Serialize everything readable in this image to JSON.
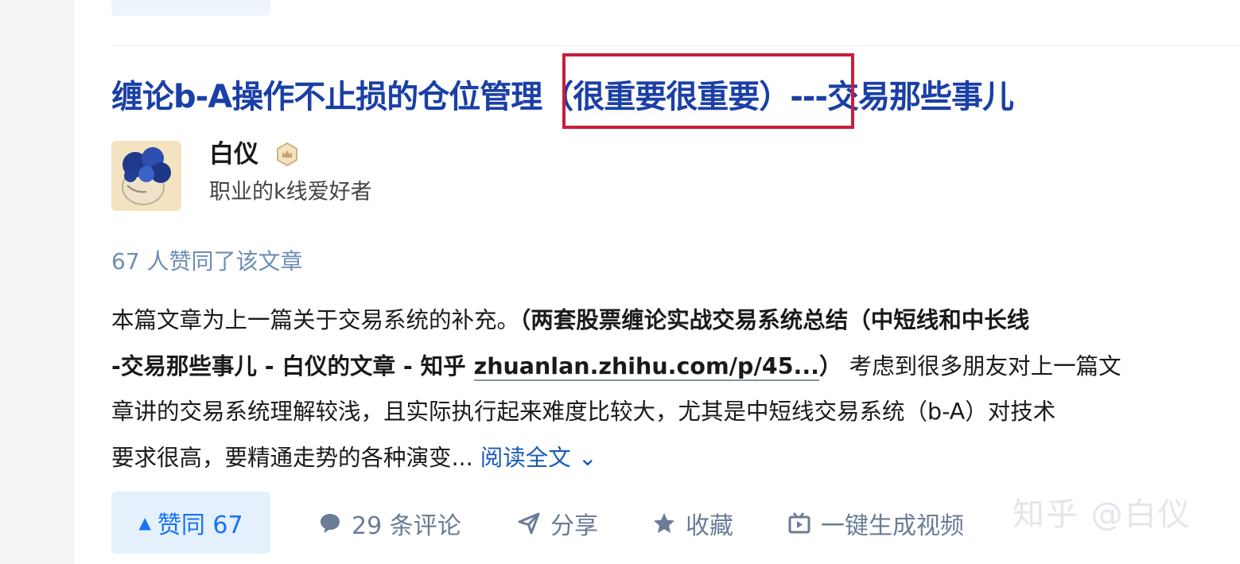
{
  "article": {
    "title_pre": "缠论b-A操作不止损的仓位管理",
    "title_highlight": "（很重要很重要）",
    "title_post": "---交易那些事儿",
    "author_name": "白仪",
    "author_bio": "职业的k线爱好者",
    "likes_text": "67 人赞同了该文章",
    "content": {
      "line1_plain": "本篇文章为上一篇关于交易系统的补充。",
      "line1_bold": "（两套股票缠论实战交易系统总结（中短线和中长线",
      "line2_bold": "-交易那些事儿 - 白仪的文章 - 知乎 ",
      "line2_link": "zhuanlan.zhihu.com/p/45...",
      "line2_close": "）",
      "line2_plain": "考虑到很多朋友对上一篇文",
      "line3": "章讲的交易系统理解较浅，且实际执行起来难度比较大，尤其是中短线交易系统（b-A）对技术",
      "line4": "要求很高，要精通走势的各种演变...",
      "read_more": "阅读全文"
    }
  },
  "actions": {
    "vote_label": "赞同 67",
    "comments_label": "29 条评论",
    "share_label": "分享",
    "favorite_label": "收藏",
    "video_label": "一键生成视频"
  },
  "watermark": "知乎 @白仪",
  "colors": {
    "title": "#1a3fa6",
    "highlight_box": "#c81d3d",
    "accent": "#1772f6",
    "meta": "#6d8db5",
    "action": "#6a7c96"
  },
  "icons": [
    "badge-icon",
    "chevron-down-icon",
    "upvote-arrow-icon",
    "comment-icon",
    "share-icon",
    "star-icon",
    "video-icon"
  ]
}
